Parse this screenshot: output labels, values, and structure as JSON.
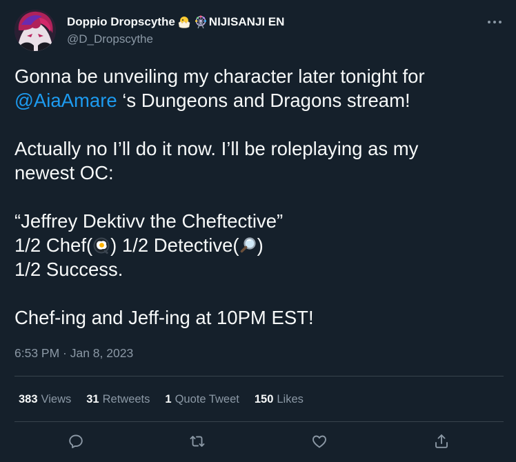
{
  "author": {
    "display_name": "Doppio Dropscythe",
    "affiliation": "NIJISANJI EN",
    "handle": "@D_Dropscythe"
  },
  "tweet": {
    "line1": "Gonna be unveiling my character later tonight for",
    "mention": "@AiaAmare",
    "line2_rest": " ‘s Dungeons and Dragons stream!",
    "line3": "Actually no I’ll do it now. I’ll be roleplaying as my",
    "line4": "newest OC:",
    "line5": "“Jeffrey Dektivv the Cheftective”",
    "line6_a": "1/2 Chef(",
    "line6_b": ") 1/2 Detective(",
    "line6_c": ")",
    "line7": "1/2 Success.",
    "line8": "Chef-ing and Jeff-ing at 10PM EST!"
  },
  "timestamp": "6:53 PM · Jan 8, 2023",
  "stats": {
    "views_count": "383",
    "views_label": "Views",
    "retweets_count": "31",
    "retweets_label": "Retweets",
    "quotes_count": "1",
    "quotes_label": "Quote Tweet",
    "likes_count": "150",
    "likes_label": "Likes"
  },
  "icons": {
    "more": "more-icon",
    "reply": "reply-icon",
    "retweet": "retweet-icon",
    "like": "heart-icon",
    "share": "share-icon",
    "chick": "hatching-chick-emoji",
    "ferris": "ferris-wheel-emoji",
    "egg": "fried-egg-emoji",
    "magnifier": "magnifier-emoji"
  },
  "colors": {
    "background": "#15202b",
    "text": "#f7f9f9",
    "secondary": "#8b98a5",
    "link": "#1d9bf0",
    "divider": "#38444d"
  }
}
